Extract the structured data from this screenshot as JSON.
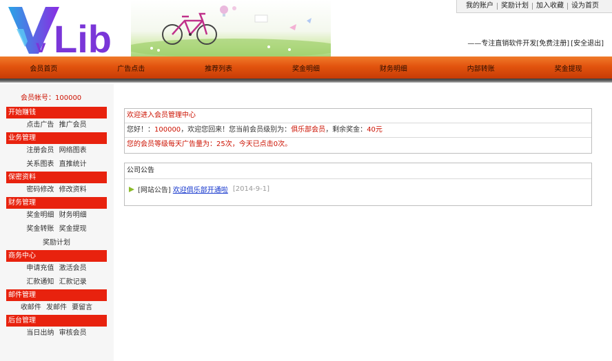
{
  "brand": {
    "logo_text": "vLib",
    "logo_colors": [
      "#2aa4e6",
      "#8a2be2"
    ]
  },
  "topnav": {
    "items": [
      "我的账户",
      "奖励计划",
      "加入收藏",
      "设为首页"
    ]
  },
  "slogan": {
    "text": "——专注直销软件开发",
    "register": "[免费注册]",
    "logout": "[安全退出]"
  },
  "mainnav": {
    "items": [
      "会员首页",
      "广告点击",
      "推荐列表",
      "奖金明细",
      "财务明细",
      "内部转账",
      "奖金提现"
    ]
  },
  "sidebar": {
    "account_label": "会员帐号：",
    "account_id": "100000",
    "sections": [
      {
        "title": "开始赚钱",
        "rows": [
          [
            "点击广告",
            "推广会员"
          ]
        ]
      },
      {
        "title": "业务管理",
        "rows": [
          [
            "注册会员",
            "网络图表"
          ],
          [
            "关系图表",
            "直推统计"
          ]
        ]
      },
      {
        "title": "保密资料",
        "rows": [
          [
            "密码修改",
            "修改资料"
          ]
        ]
      },
      {
        "title": "财务管理",
        "rows": [
          [
            "奖金明细",
            "财务明细"
          ],
          [
            "奖金转账",
            "奖金提现"
          ],
          [
            "奖励计划"
          ]
        ]
      },
      {
        "title": "商务中心",
        "rows": [
          [
            "申请充值",
            "激活会员"
          ],
          [
            "汇款通知",
            "汇款记录"
          ]
        ]
      },
      {
        "title": "邮件管理",
        "rows": [
          [
            "收邮件",
            "发邮件",
            "要留言"
          ]
        ]
      },
      {
        "title": "后台管理",
        "rows": [
          [
            "当日出纳",
            "审核会员"
          ]
        ]
      }
    ]
  },
  "welcome": {
    "title": "欢迎进入会员管理中心",
    "greeting_prefix": "您好！：",
    "user_id": "100000",
    "greeting_mid": "，欢迎您回来！您当前会员级别为：",
    "level": "俱乐部会员",
    "balance_label": "，剩余奖金：",
    "balance": "40元",
    "ad_line": "您的会员等级每天广告量为：25次，今天已点击0次。"
  },
  "announcements": {
    "title": "公司公告",
    "items": [
      {
        "tag": "[网站公告]",
        "link": "欢迎俱乐部开通啦",
        "date": "[2014-9-1]"
      }
    ]
  }
}
